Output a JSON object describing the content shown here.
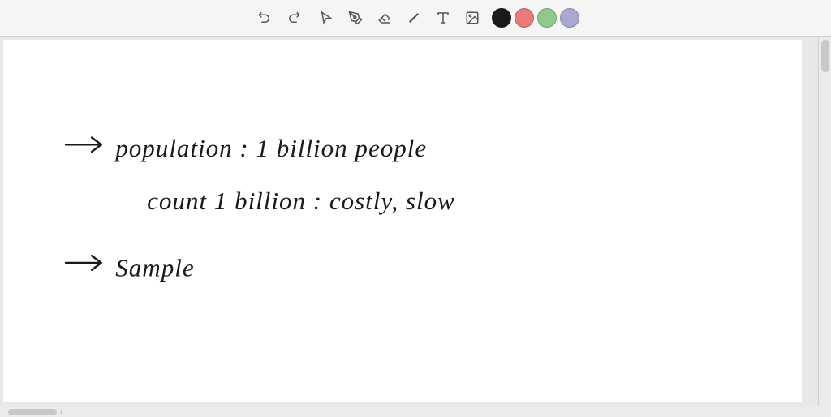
{
  "toolbar": {
    "tools": [
      {
        "name": "undo",
        "icon": "↺",
        "label": "Undo"
      },
      {
        "name": "redo",
        "icon": "↻",
        "label": "Redo"
      },
      {
        "name": "select",
        "icon": "↖",
        "label": "Select"
      },
      {
        "name": "pen",
        "icon": "✏",
        "label": "Pen"
      },
      {
        "name": "eraser",
        "icon": "✂",
        "label": "Eraser"
      },
      {
        "name": "highlighter",
        "icon": "/",
        "label": "Highlighter"
      },
      {
        "name": "text",
        "icon": "A",
        "label": "Text"
      },
      {
        "name": "image",
        "icon": "▣",
        "label": "Image"
      }
    ],
    "colors": [
      {
        "name": "black",
        "hex": "#1a1a1a"
      },
      {
        "name": "pink",
        "hex": "#e87a7a"
      },
      {
        "name": "green",
        "hex": "#8fc98f"
      },
      {
        "name": "purple",
        "hex": "#a9a8d0"
      }
    ]
  },
  "content": {
    "line1": "→  population : 1 billion  people",
    "line2": "count  1 billion :   costly, slow",
    "line3": "→  Sample"
  }
}
